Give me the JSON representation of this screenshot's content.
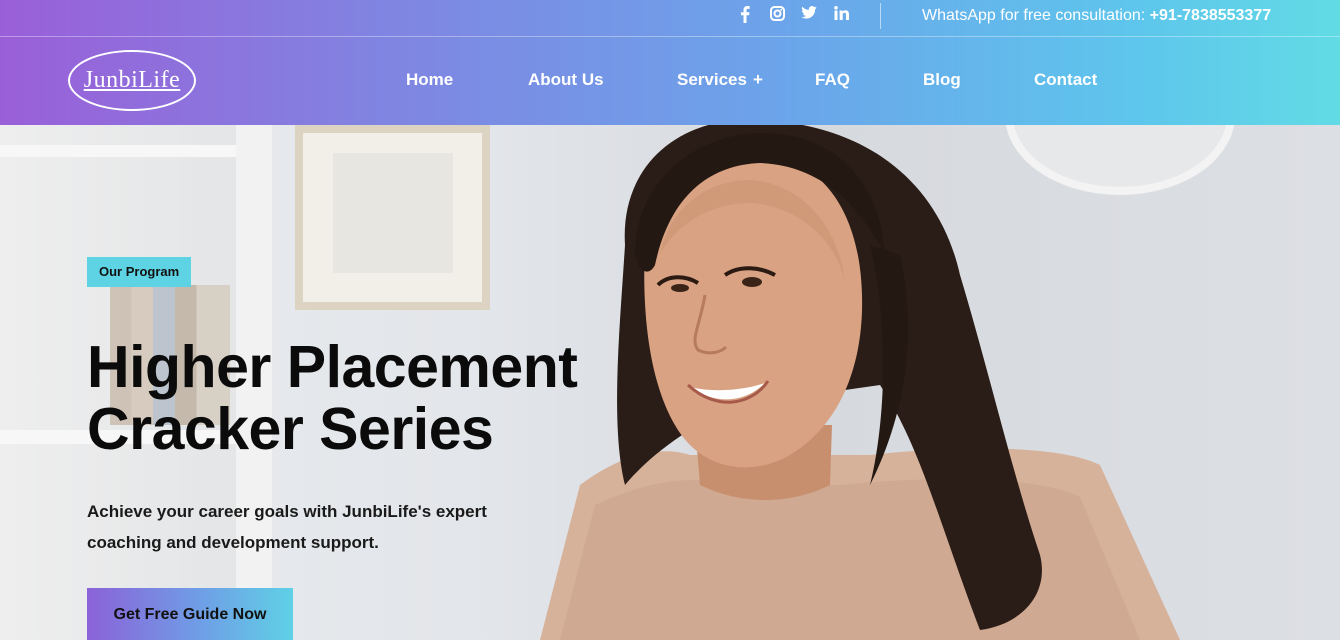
{
  "header": {
    "social": [
      {
        "name": "facebook-icon"
      },
      {
        "name": "instagram-icon"
      },
      {
        "name": "twitter-icon"
      },
      {
        "name": "linkedin-icon"
      }
    ],
    "whatsapp_text": "WhatsApp for free consultation: ",
    "whatsapp_number": "+91-7838553377",
    "logo_text": "JunbiLife",
    "nav": [
      {
        "label": "Home"
      },
      {
        "label": "About Us"
      },
      {
        "label": "Services",
        "has_submenu_symbol": "+"
      },
      {
        "label": "FAQ"
      },
      {
        "label": "Blog"
      },
      {
        "label": "Contact"
      }
    ]
  },
  "hero": {
    "tag": "Our Program",
    "headline_line1": "Higher Placement",
    "headline_line2": "Cracker Series",
    "description_line1": "Achieve your career goals with JunbiLife's expert",
    "description_line2": "coaching and development support.",
    "cta_label": "Get Free Guide Now"
  },
  "colors": {
    "gradient_start": "#9a5fd8",
    "gradient_end": "#62dbe5",
    "tag_bg": "#5ed3e4",
    "text_dark": "#0b0b0b"
  }
}
